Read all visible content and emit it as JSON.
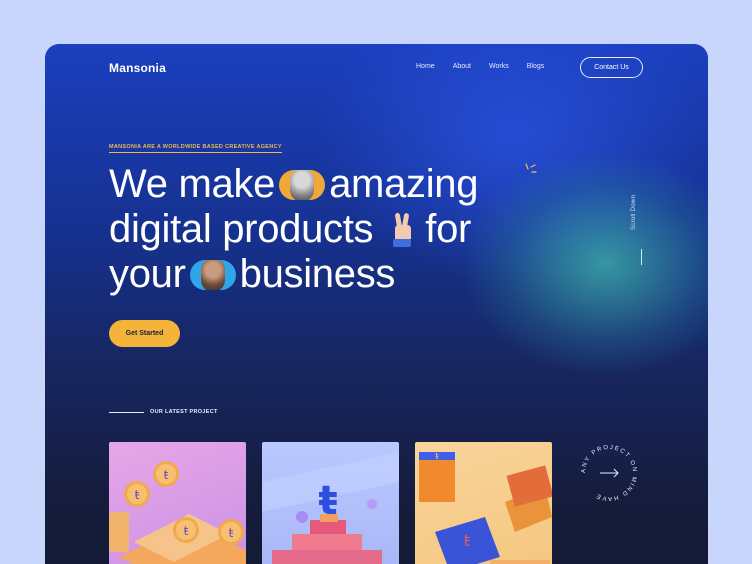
{
  "brand": {
    "name": "Mansonia"
  },
  "nav": {
    "items": [
      {
        "label": "Home"
      },
      {
        "label": "About"
      },
      {
        "label": "Works"
      },
      {
        "label": "Blogs"
      }
    ],
    "contact_label": "Contact Us"
  },
  "hero": {
    "eyebrow": "MANSONIA ARE A WORLDWIDE BASED CREATIVE AGENCY",
    "line1_a": "We make",
    "line1_b": "amazing",
    "line2_a": "digital products",
    "line2_b": "for",
    "line3_a": "your",
    "line3_b": "business",
    "cta_label": "Get Started"
  },
  "side": {
    "scroll_label": "Scroll Down"
  },
  "latest": {
    "label": "OUR LATEST PROJECT",
    "badge_text": "ANY PROJECT ON MIND HAVE"
  },
  "colors": {
    "accent": "#f4b43a",
    "page_bg": "#c9d6fb",
    "hero_bg": "#1b3fbf",
    "teal_glow": "#40baaa"
  },
  "icons": {
    "hero_sparkle": "sparkle-icon",
    "hero_hand": "victory-hand-icon",
    "badge_arrow": "arrow-right-icon"
  }
}
